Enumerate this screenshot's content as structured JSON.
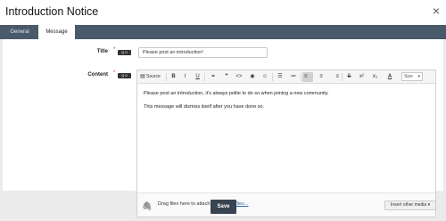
{
  "window": {
    "title": "Introduction Notice",
    "close_glyph": "×"
  },
  "tabs": [
    {
      "label": "General"
    },
    {
      "label": "Message"
    }
  ],
  "form": {
    "title_label": "Title",
    "content_label": "Content",
    "required_marker": "*",
    "badge_text": "Q 0",
    "title_value": "Please post an introduction!"
  },
  "toolbar": {
    "source_label": "Source",
    "bold": "B",
    "italic": "I",
    "underline": "U",
    "link_glyph": "⚭",
    "quote_glyph": "❞",
    "code_glyph": "<>",
    "spoiler_glyph": "◉",
    "emoji_glyph": "☺",
    "ul_glyph": "☰",
    "ol_glyph": "≔",
    "align_left_glyph": "≡",
    "align_center_glyph": "≡",
    "align_right_glyph": "≡",
    "strike": "S",
    "superscript": "x²",
    "subscript": "x₂",
    "font_color": "A",
    "size_label": "Size",
    "size_caret": "▾"
  },
  "editor": {
    "paragraph1": "Please post an introduction, it's always polite to do so when joining a new community.",
    "paragraph2": "This message will dismiss itself after you have done so."
  },
  "attach": {
    "paperclip_glyph": "🖇",
    "text": "Drag files here to attach, or ",
    "link": "choose files...",
    "insert_media": "Insert other media ▾"
  },
  "footer": {
    "save_label": "Save"
  }
}
